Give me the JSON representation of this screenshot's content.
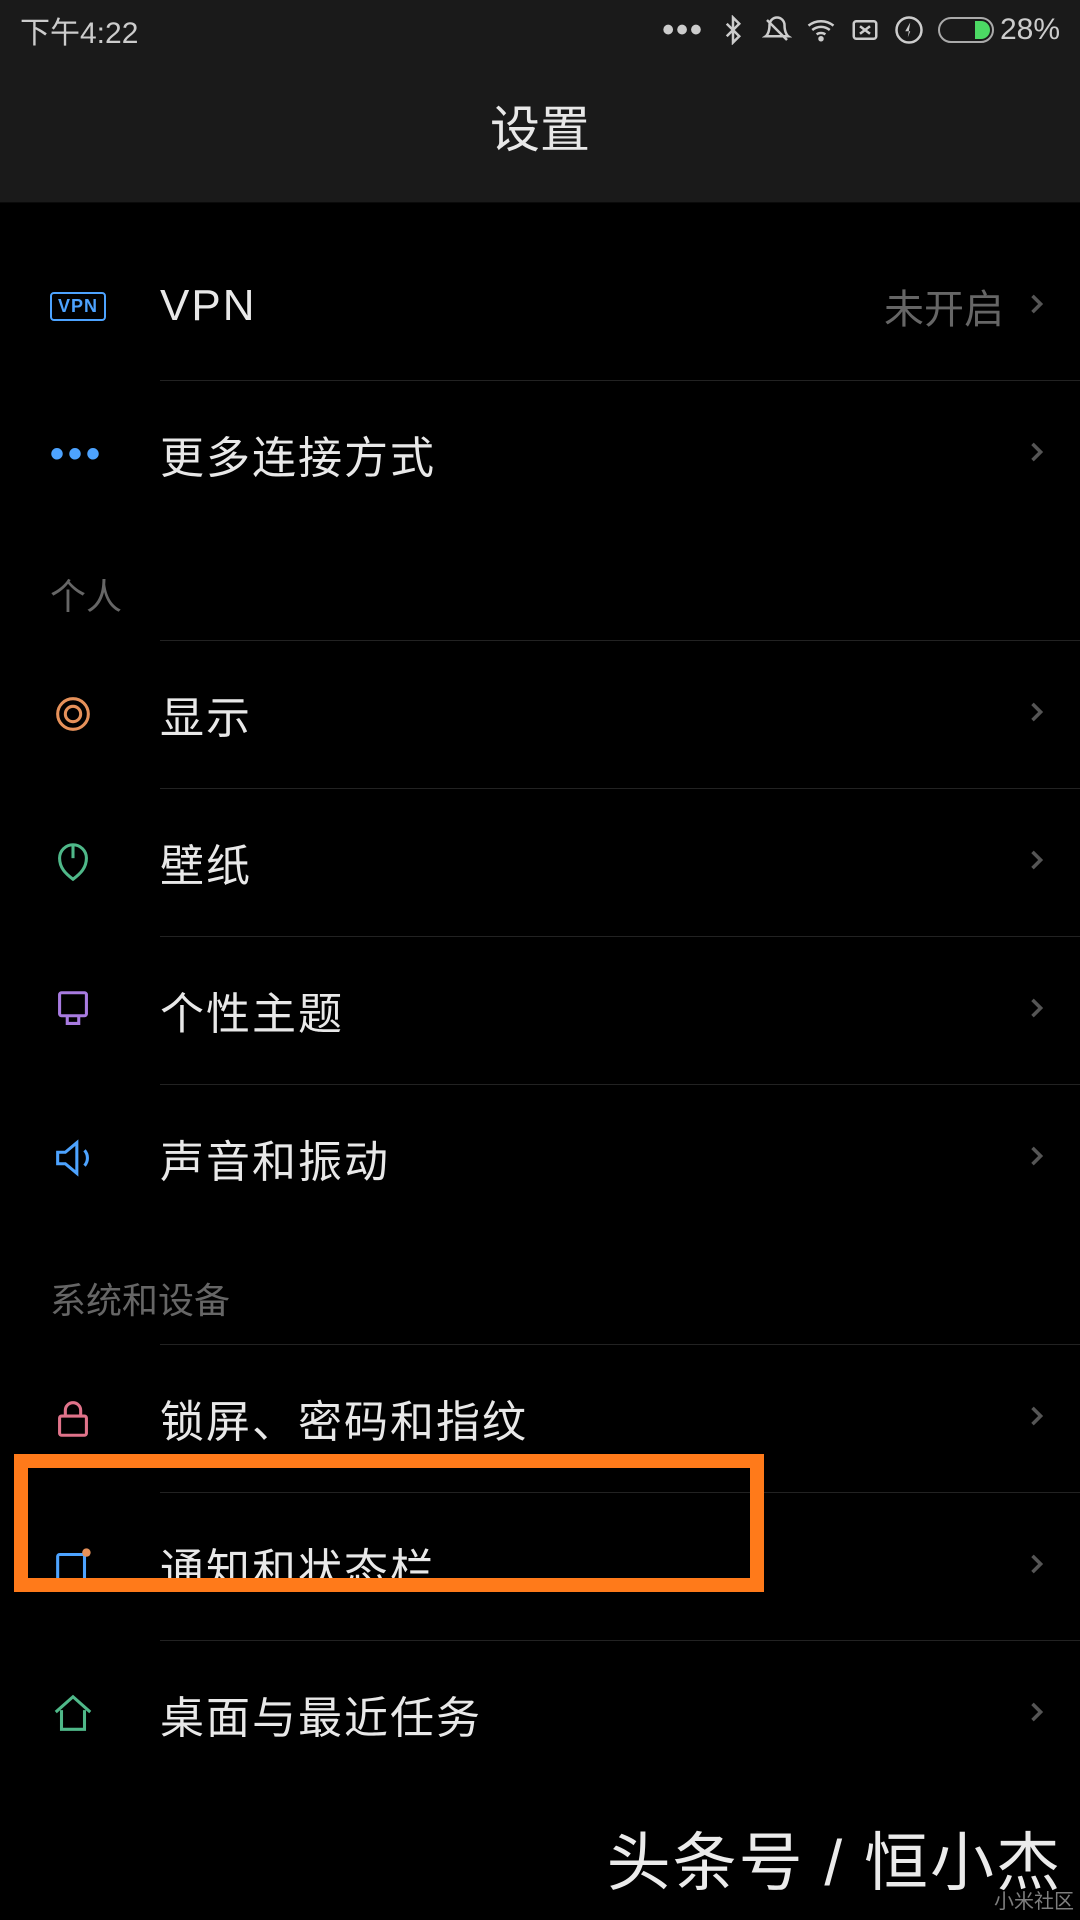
{
  "statusbar": {
    "time": "下午4:22",
    "battery_pct": "28%"
  },
  "header": {
    "title": "设置"
  },
  "items": {
    "vpn": {
      "label": "VPN",
      "value": "未开启"
    },
    "more_conn": {
      "label": "更多连接方式"
    },
    "section_personal": "个人",
    "display": {
      "label": "显示"
    },
    "wallpaper": {
      "label": "壁纸"
    },
    "theme": {
      "label": "个性主题"
    },
    "sound": {
      "label": "声音和振动"
    },
    "section_system": "系统和设备",
    "lockscreen": {
      "label": "锁屏、密码和指纹"
    },
    "notification": {
      "label": "通知和状态栏"
    },
    "desktop": {
      "label": "桌面与最近任务"
    }
  },
  "watermarks": {
    "main": "头条号 / 恒小杰",
    "small": "小米社区"
  }
}
